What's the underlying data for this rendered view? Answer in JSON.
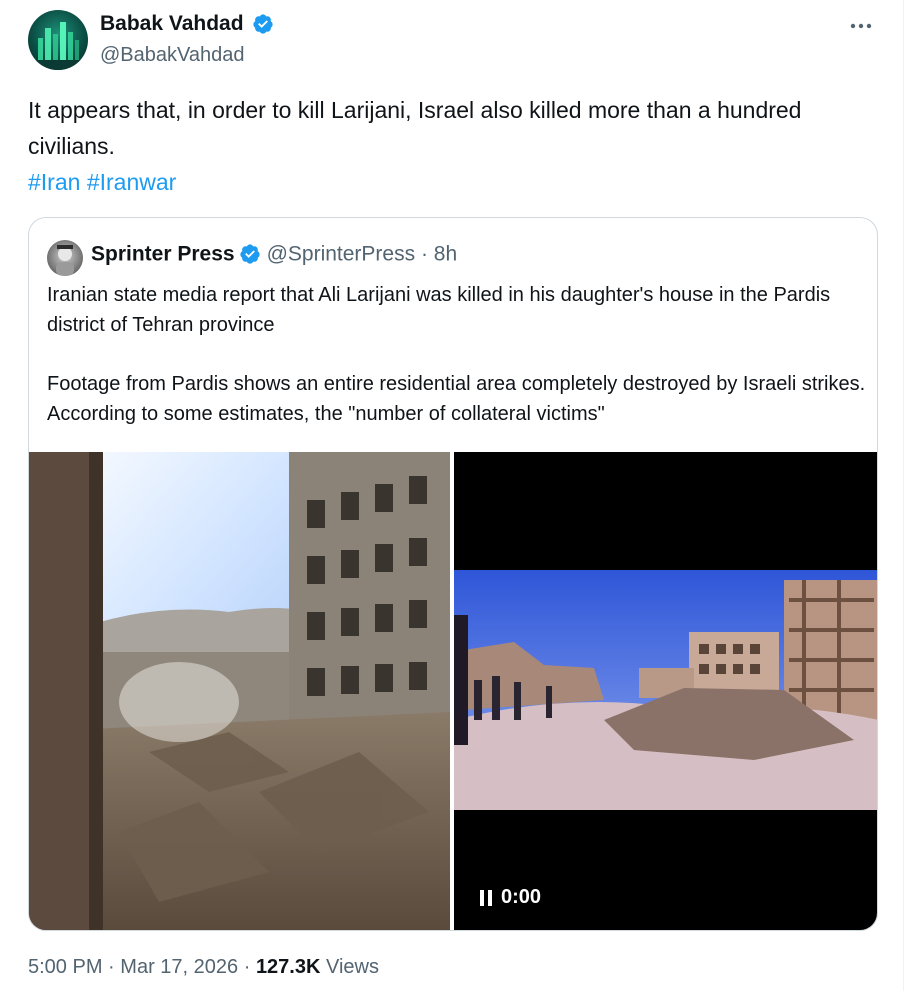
{
  "author": {
    "name": "Babak Vahdad",
    "handle": "@BabakVahdad",
    "verified_icon": "verified-badge-icon"
  },
  "tweet": {
    "text": "It appears that, in order to kill Larijani, Israel also killed more than a hundred civilians.",
    "hashtags": [
      "#Iran",
      "#Iranwar"
    ]
  },
  "quote": {
    "name": "Sprinter Press",
    "handle": "@SprinterPress",
    "separator": "·",
    "time": "8h",
    "paragraph1": "Iranian state media report that Ali Larijani was killed in his daughter's house in the Pardis district of Tehran province",
    "paragraph2": "Footage from Pardis shows an entire residential area completely destroyed by Israeli strikes. According to some estimates, the \"number of collateral victims\"",
    "video": {
      "timestamp": "0:00"
    }
  },
  "footer": {
    "time": "5:00 PM",
    "sep1": "·",
    "date": "Mar 17, 2026",
    "sep2": "·",
    "views_count": "127.3K",
    "views_label": "Views"
  },
  "colors": {
    "link": "#1d9bf0",
    "secondary_text": "#536471",
    "verified": "#1d9bf0"
  }
}
